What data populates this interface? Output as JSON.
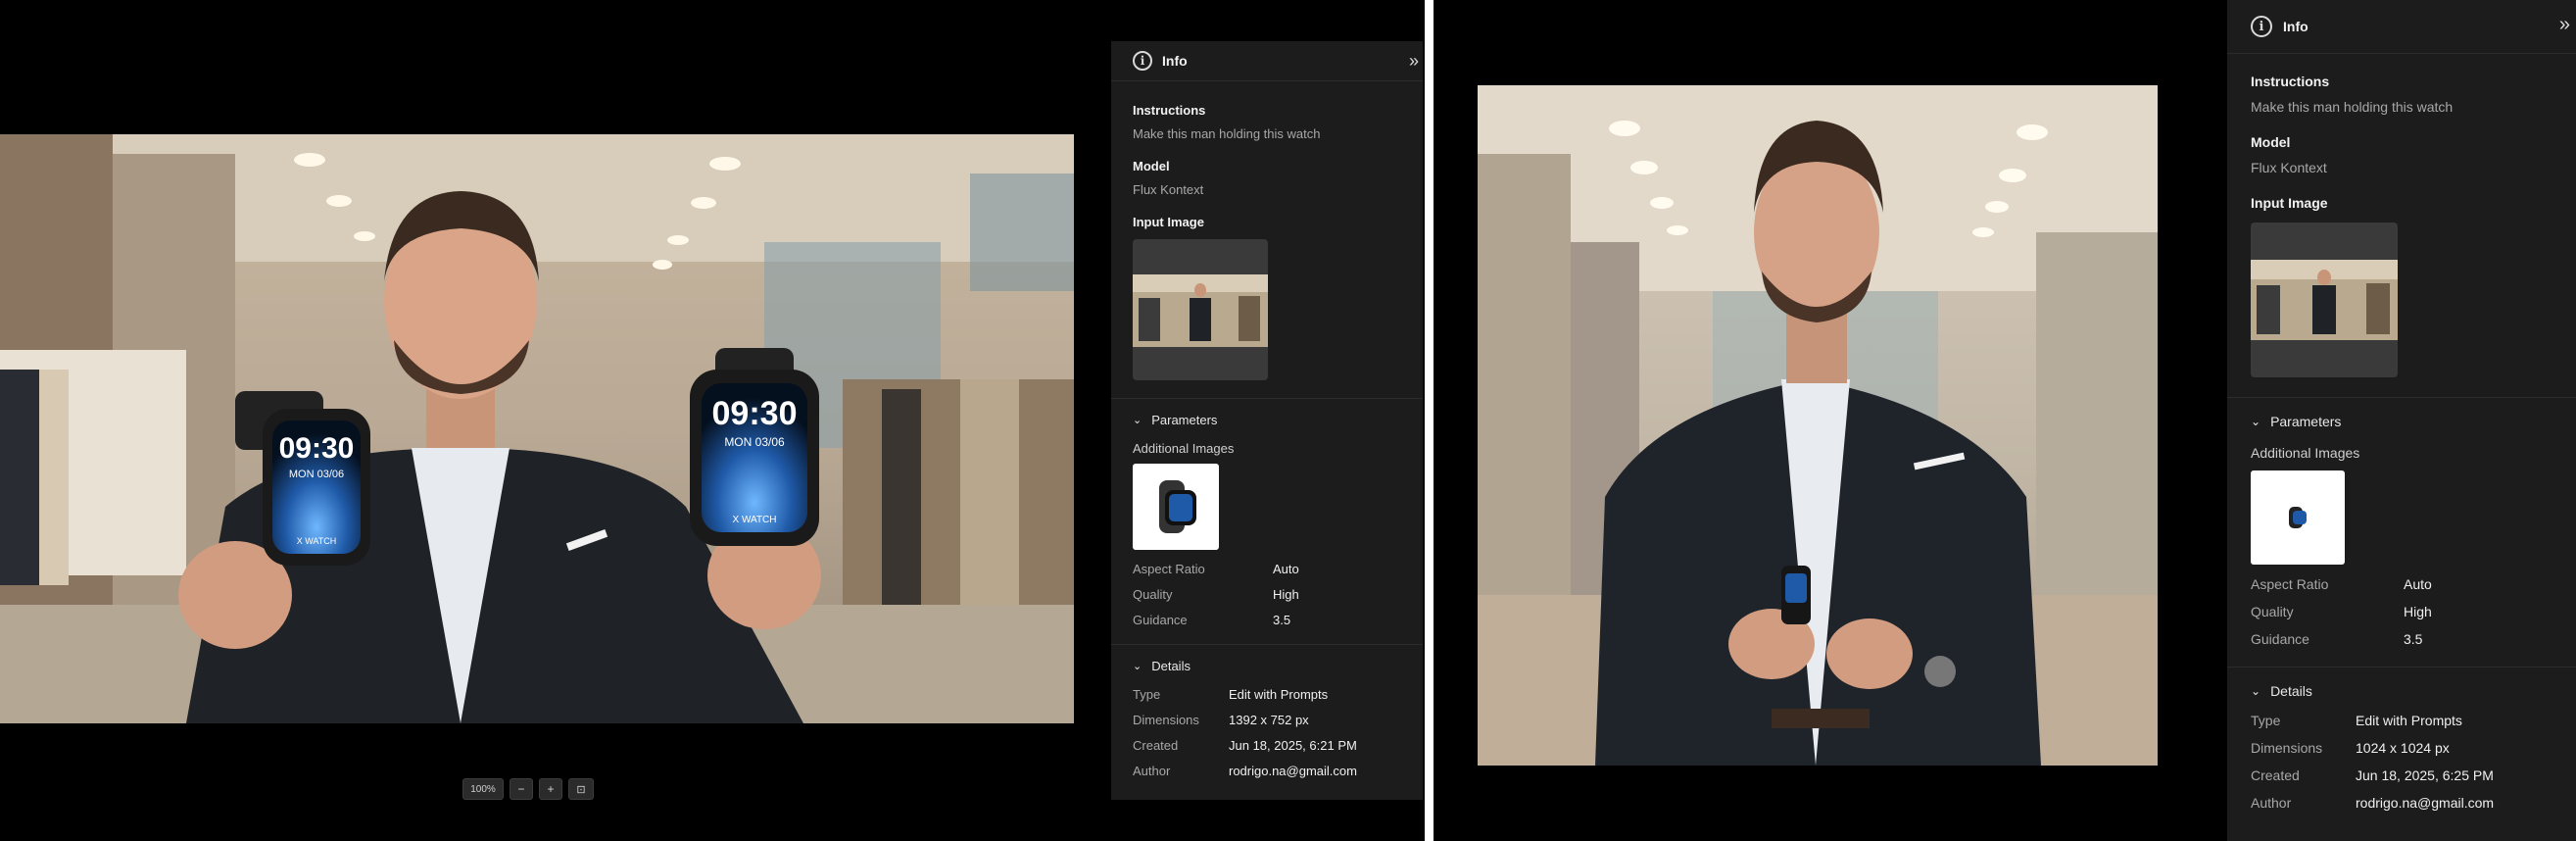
{
  "left": {
    "panel": {
      "title": "Info",
      "instructions_label": "Instructions",
      "instructions_value": "Make this man holding this watch",
      "model_label": "Model",
      "model_value": "Flux Kontext",
      "input_image_label": "Input Image",
      "parameters_label": "Parameters",
      "additional_images_label": "Additional Images",
      "params": [
        {
          "k": "Aspect Ratio",
          "v": "Auto"
        },
        {
          "k": "Quality",
          "v": "High"
        },
        {
          "k": "Guidance",
          "v": "3.5"
        }
      ],
      "details_label": "Details",
      "details": [
        {
          "k": "Type",
          "v": "Edit with Prompts"
        },
        {
          "k": "Dimensions",
          "v": "1392 x 752 px"
        },
        {
          "k": "Created",
          "v": "Jun 18, 2025, 6:21 PM"
        },
        {
          "k": "Author",
          "v": "rodrigo.na@gmail.com"
        }
      ]
    },
    "photo": {
      "watch_time": "09:30",
      "watch_date": "MON 03/06",
      "watch_brand": "X WATCH"
    },
    "toolbar": {
      "zoom_level": "100%",
      "zoom_out": "−",
      "zoom_in": "+",
      "fit": "⊡"
    }
  },
  "right": {
    "panel": {
      "title": "Info",
      "instructions_label": "Instructions",
      "instructions_value": "Make this man holding this watch",
      "model_label": "Model",
      "model_value": "Flux Kontext",
      "input_image_label": "Input Image",
      "parameters_label": "Parameters",
      "additional_images_label": "Additional Images",
      "params": [
        {
          "k": "Aspect Ratio",
          "v": "Auto"
        },
        {
          "k": "Quality",
          "v": "High"
        },
        {
          "k": "Guidance",
          "v": "3.5"
        }
      ],
      "details_label": "Details",
      "details": [
        {
          "k": "Type",
          "v": "Edit with Prompts"
        },
        {
          "k": "Dimensions",
          "v": "1024 x 1024 px"
        },
        {
          "k": "Created",
          "v": "Jun 18, 2025, 6:25 PM"
        },
        {
          "k": "Author",
          "v": "rodrigo.na@gmail.com"
        }
      ]
    }
  },
  "icons": {
    "info": "info-circle-icon",
    "collapse": "double-chevron-right-icon",
    "chevron": "chevron-down-icon"
  }
}
